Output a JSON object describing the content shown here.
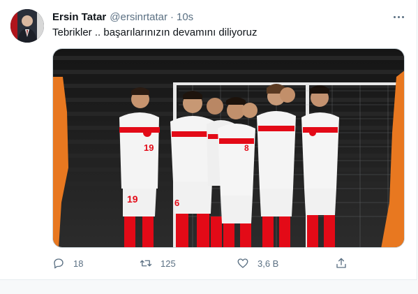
{
  "tweet": {
    "author_name": "Ersin Tatar",
    "handle": "@ersinrtatar",
    "separator": "·",
    "time": "10s",
    "text": "Tebrikler .. başarılarınızın devamını diliyoruz",
    "avatar_icon": "profile-photo",
    "more_icon": "more-options-icon",
    "media_description_icon": "team-photo",
    "actions": {
      "reply": {
        "icon": "reply-icon",
        "count": "18"
      },
      "retweet": {
        "icon": "retweet-icon",
        "count": "125"
      },
      "like": {
        "icon": "heart-icon",
        "count": "3,6 B"
      },
      "share": {
        "icon": "share-icon"
      }
    }
  },
  "colors": {
    "text_primary": "#0f1419",
    "text_secondary": "#5b7083",
    "border": "#e6ecf0",
    "jersey_red": "#e30a17"
  }
}
